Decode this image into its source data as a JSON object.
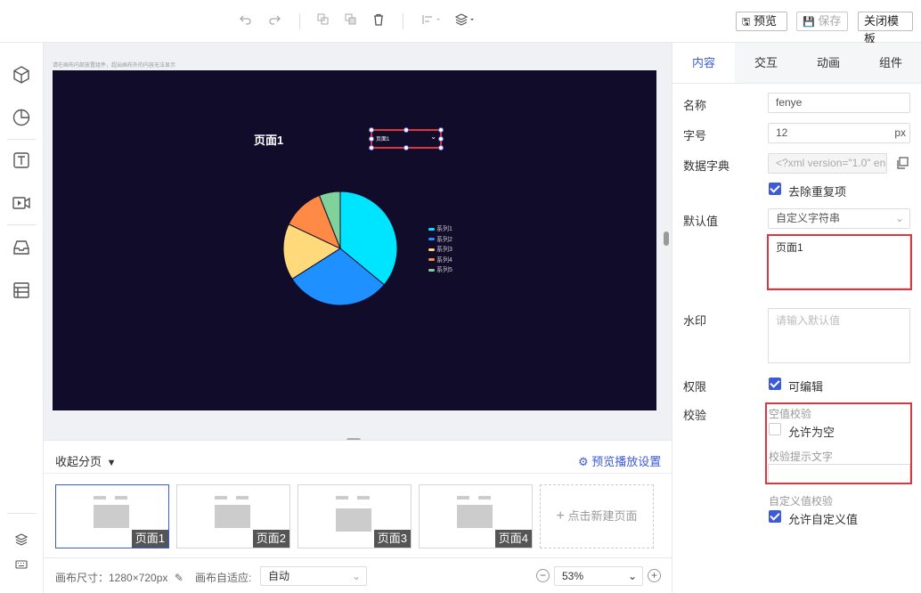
{
  "toolbar": {
    "preview_label": "预览",
    "save_label": "保存",
    "close_label": "关闭模板"
  },
  "canvas": {
    "hint": "请在画布内部放置组件，超出画布外的内容无法显示",
    "title_text": "页面1",
    "select_value": "页面1"
  },
  "chart_data": {
    "type": "pie",
    "series": [
      {
        "name": "系列1",
        "value": 36,
        "color": "#00e5ff"
      },
      {
        "name": "系列2",
        "value": 30,
        "color": "#1e90ff"
      },
      {
        "name": "系列3",
        "value": 16,
        "color": "#ffd97a"
      },
      {
        "name": "系列4",
        "value": 12,
        "color": "#ff8a45"
      },
      {
        "name": "系列5",
        "value": 6,
        "color": "#7fd39a"
      }
    ],
    "legend_position": "right"
  },
  "pages": {
    "collapse_label": "收起分页",
    "preview_settings_label": "预览播放设置",
    "items": [
      {
        "label": "页面1"
      },
      {
        "label": "页面2"
      },
      {
        "label": "页面3"
      },
      {
        "label": "页面4"
      }
    ],
    "new_page_label": "点击新建页面"
  },
  "footer": {
    "canvas_size_label": "画布尺寸：1280×720px",
    "adapt_label": "画布自适应:",
    "adapt_value": "自动",
    "zoom_value": "53%"
  },
  "panel": {
    "tabs": [
      "内容",
      "交互",
      "动画",
      "组件"
    ],
    "name_label": "名称",
    "name_value": "fenye",
    "font_label": "字号",
    "font_value": "12",
    "font_unit": "px",
    "dict_label": "数据字典",
    "dict_value": "<?xml version=\"1.0\" en",
    "dedupe_label": "去除重复项",
    "default_label": "默认值",
    "default_type": "自定义字符串",
    "default_value": "页面1",
    "watermark_label": "水印",
    "watermark_placeholder": "请输入默认值",
    "permission_label": "权限",
    "editable_label": "可编辑",
    "validate_label": "校验",
    "empty_check_label": "空值校验",
    "allow_empty_label": "允许为空",
    "hint_text_label": "校验提示文字",
    "custom_check_label": "自定义值校验",
    "allow_custom_label": "允许自定义值"
  }
}
